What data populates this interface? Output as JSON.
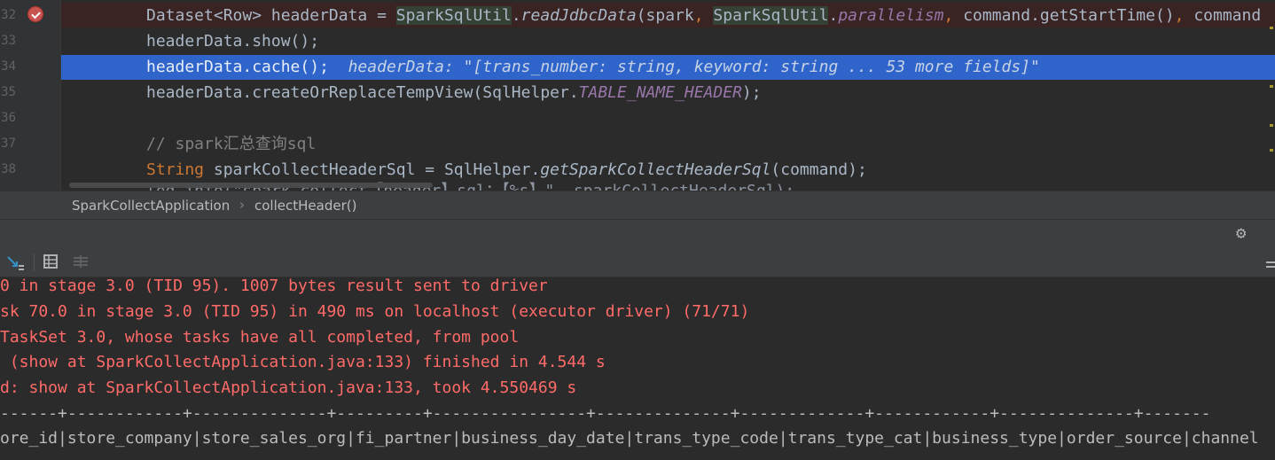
{
  "editor": {
    "line_numbers": [
      "32",
      "33",
      "34",
      "35",
      "36",
      "37",
      "38"
    ],
    "line32": {
      "p1": "Dataset<Row> headerData = ",
      "cls1": "SparkSqlUtil",
      "p2": ".",
      "m1": "readJdbcData",
      "p3": "(spark",
      "c1": ", ",
      "cls2": "SparkSqlUtil",
      "p4": ".",
      "f1": "parallelism",
      "c2": ", ",
      "p5": "command.getStartTime()",
      "c3": ", ",
      "p6": "command"
    },
    "line33": "headerData.show();",
    "line34": {
      "code": "headerData.cache();",
      "inline_value": "headerData: \"[trans_number: string, keyword: string ... 53 more fields]\""
    },
    "line35": {
      "p1": "headerData.createOrReplaceTempView(SqlHelper.",
      "f1": "TABLE_NAME_HEADER",
      "p2": ");"
    },
    "line37": "// spark汇总查询sql",
    "line38": {
      "kw": "String",
      "p1": " sparkCollectHeaderSql = SqlHelper.",
      "m1": "getSparkCollectHeaderSql",
      "p2": "(command);"
    },
    "line39_partial": "log.info(\"spark collect【header】sql：【%s】\", sparkCollectHeaderSql);"
  },
  "breadcrumb": {
    "class_name": "SparkCollectApplication",
    "separator": "›",
    "method_name": "collectHeader()"
  },
  "toolbar": {
    "icons": [
      "scroll-to-end-icon",
      "table-icon",
      "columns-icon",
      "gear-icon",
      "menu-icon"
    ]
  },
  "console": {
    "lines": [
      "0 in stage 3.0 (TID 95). 1007 bytes result sent to driver",
      "sk 70.0 in stage 3.0 (TID 95) in 490 ms on localhost (executor driver) (71/71)",
      "TaskSet 3.0, whose tasks have all completed, from pool",
      " (show at SparkCollectApplication.java:133) finished in 4.544 s",
      "d: show at SparkCollectApplication.java:133, took 4.550469 s"
    ],
    "table_border": "------+------------+--------------+---------+----------------+--------------+-------------+------------+--------------+-------",
    "table_header": "ore_id|store_company|store_sales_org|fi_partner|business_day_date|trans_type_code|trans_type_cat|business_type|order_source|channel"
  },
  "colors": {
    "editor_bg": "#2b2b2b",
    "selection": "#2f65ca",
    "error_text": "#ff6b68",
    "keyword": "#cc7832"
  }
}
